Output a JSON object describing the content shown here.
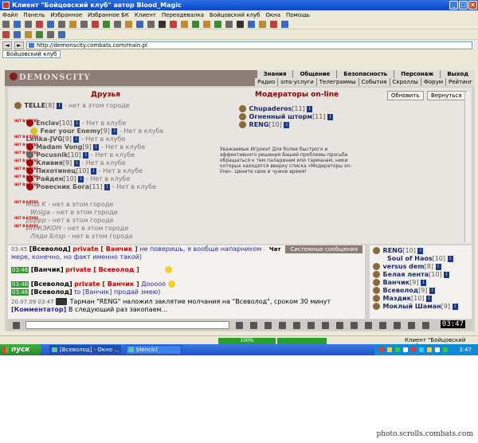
{
  "window": {
    "title": "Клиент \"Бойцовский клуб\" автор Blood_Magic",
    "min": "_",
    "max": "□",
    "close": "x"
  },
  "menu": [
    "Файл",
    "Панель",
    "Избранное",
    "Избранное БК",
    "Клиент",
    "Переодевалка",
    "Бойцовский клуб",
    "Окна",
    "Помощь"
  ],
  "address": {
    "back": "◄",
    "forward": "►",
    "url": "http://demonscity.combats.com/main.pl"
  },
  "page_tab": "Бойцовский клуб",
  "game": {
    "logo": "DEMONSCITY",
    "top_nav": [
      "Знания",
      "Общение",
      "Безопасность",
      "Персонаж",
      "Выход"
    ],
    "sub_nav": [
      "Радио",
      "sms-услуги",
      "Телеграммы",
      "События",
      "Скроллы",
      "Форум",
      "Рейтинг"
    ],
    "badge_text": "НЕТ В КЛУБЕ",
    "friends_title": "Друзья",
    "moderators_title": "Модераторы on-line",
    "refresh_btn": "Обновить",
    "back_btn": "Вернуться",
    "friends": [
      {
        "nick": "TELLE",
        "level": "[8]",
        "status": "- нет в этом городе"
      },
      {
        "nick": "Enclav",
        "level": "[10]",
        "status": "- Нет в клубе"
      },
      {
        "nick": "Fear your Enemy",
        "level": "[9]",
        "status": "- Нет в клубе"
      },
      {
        "nick": "Lenka-JVG",
        "level": "[9]",
        "status": "- Нет в клубе"
      },
      {
        "nick": "Madam Vong",
        "level": "[9]",
        "status": "- Нет в клубе"
      },
      {
        "nick": "Pocusnik",
        "level": "[10]",
        "status": "- Нет в клубе"
      },
      {
        "nick": "Кливия",
        "level": "[9]",
        "status": "- Нет в клубе"
      },
      {
        "nick": "Пихотинец",
        "level": "[10]",
        "status": "- Нет в клубе"
      },
      {
        "nick": "Райден",
        "level": "[10]",
        "status": "- Нет в клубе"
      },
      {
        "nick": "Ровесник Бога",
        "level": "[11]",
        "status": "- Нет в клубе"
      },
      {
        "nick": "Miss K",
        "level": "",
        "status": "- нет в этом городе"
      },
      {
        "nick": "Wolga",
        "level": "",
        "status": "- нет в этом городе"
      },
      {
        "nick": "ррррр",
        "level": "",
        "status": "- нет в этом городе"
      },
      {
        "nick": "ИНЖЭКОН",
        "level": "",
        "status": "- нет в этом городе"
      },
      {
        "nick": "Ляди Блэр",
        "level": "",
        "status": "- нет в этом городе"
      }
    ],
    "moderators": [
      {
        "nick": "Chupaderos",
        "level": "[11]"
      },
      {
        "nick": "Огненный шторм",
        "level": "[11]"
      },
      {
        "nick": "RENG",
        "level": "[10]"
      }
    ],
    "moderators_text": "Уважаемые Игроки! Для более быстрого и эффективного решения Вашей проблемы просьба обращаться к тем паладинам или тарманам, ники которых находятся вверху списка «Модераторы on-line». Цените свое и чужое время!"
  },
  "chat": {
    "tab_chat": "Чат",
    "tab_system": "Системные сообщения",
    "lines": [
      {
        "time": "03:45",
        "who": "[Всеволод]",
        "priv": "private [ Ванчик ]",
        "msg": "не поверишь, я вообще напарником х"
      },
      {
        "time": "",
        "who": "",
        "priv": "",
        "msg": "мере, конечно, но факт именно такой)"
      },
      {
        "time": "03:46",
        "who": "[Ванчик]",
        "priv": "private [ Всеволод ]",
        "msg": ""
      },
      {
        "time": "03:46",
        "who": "[Всеволод]",
        "priv": "private [ Ванчик ]",
        "msg": "Дооооо"
      },
      {
        "time": "03:46",
        "who": "[Всеволод]",
        "priv": "to [Ванчик]",
        "msg": "продай змею)"
      },
      {
        "time": "20.07.09 03:47",
        "who": "",
        "priv": "",
        "msg": "Тарман \"RENG\" наложил заклятие молчания на \"Всеволод\", сроком 30 минут"
      },
      {
        "time": "",
        "who": "[Комментатор]",
        "priv": "",
        "msg": "В следующий раз закопаем..."
      }
    ]
  },
  "online": [
    {
      "nick": "RENG",
      "level": "[10]"
    },
    {
      "nick": "Soul of Haos",
      "level": "[10]"
    },
    {
      "nick": "versus dem",
      "level": "[8]"
    },
    {
      "nick": "Белая лента",
      "level": "[10]"
    },
    {
      "nick": "Ванчик",
      "level": "[9]"
    },
    {
      "nick": "Всеволод",
      "level": "[9]"
    },
    {
      "nick": "Маздик",
      "level": "[10]"
    },
    {
      "nick": "Моклый Шаман",
      "level": "[9]"
    }
  ],
  "clock": "03:47",
  "status": {
    "progress": "100%",
    "text": "Клиент \"Бойцовский клуб\""
  },
  "taskbar": {
    "start": "пуск",
    "task1": "[Всеволод] - Окно ...",
    "task2": "blencicl",
    "tray_time": "3:47"
  },
  "watermark": "photo.scrolls.combats.com",
  "colors": {
    "titlebar": "#0a48c8",
    "game_header": "#8c7e76",
    "title_red": "#8b0000",
    "private_red": "#cc0000",
    "taskbar": "#1c55c9",
    "start_green": "#2a8a2a"
  }
}
